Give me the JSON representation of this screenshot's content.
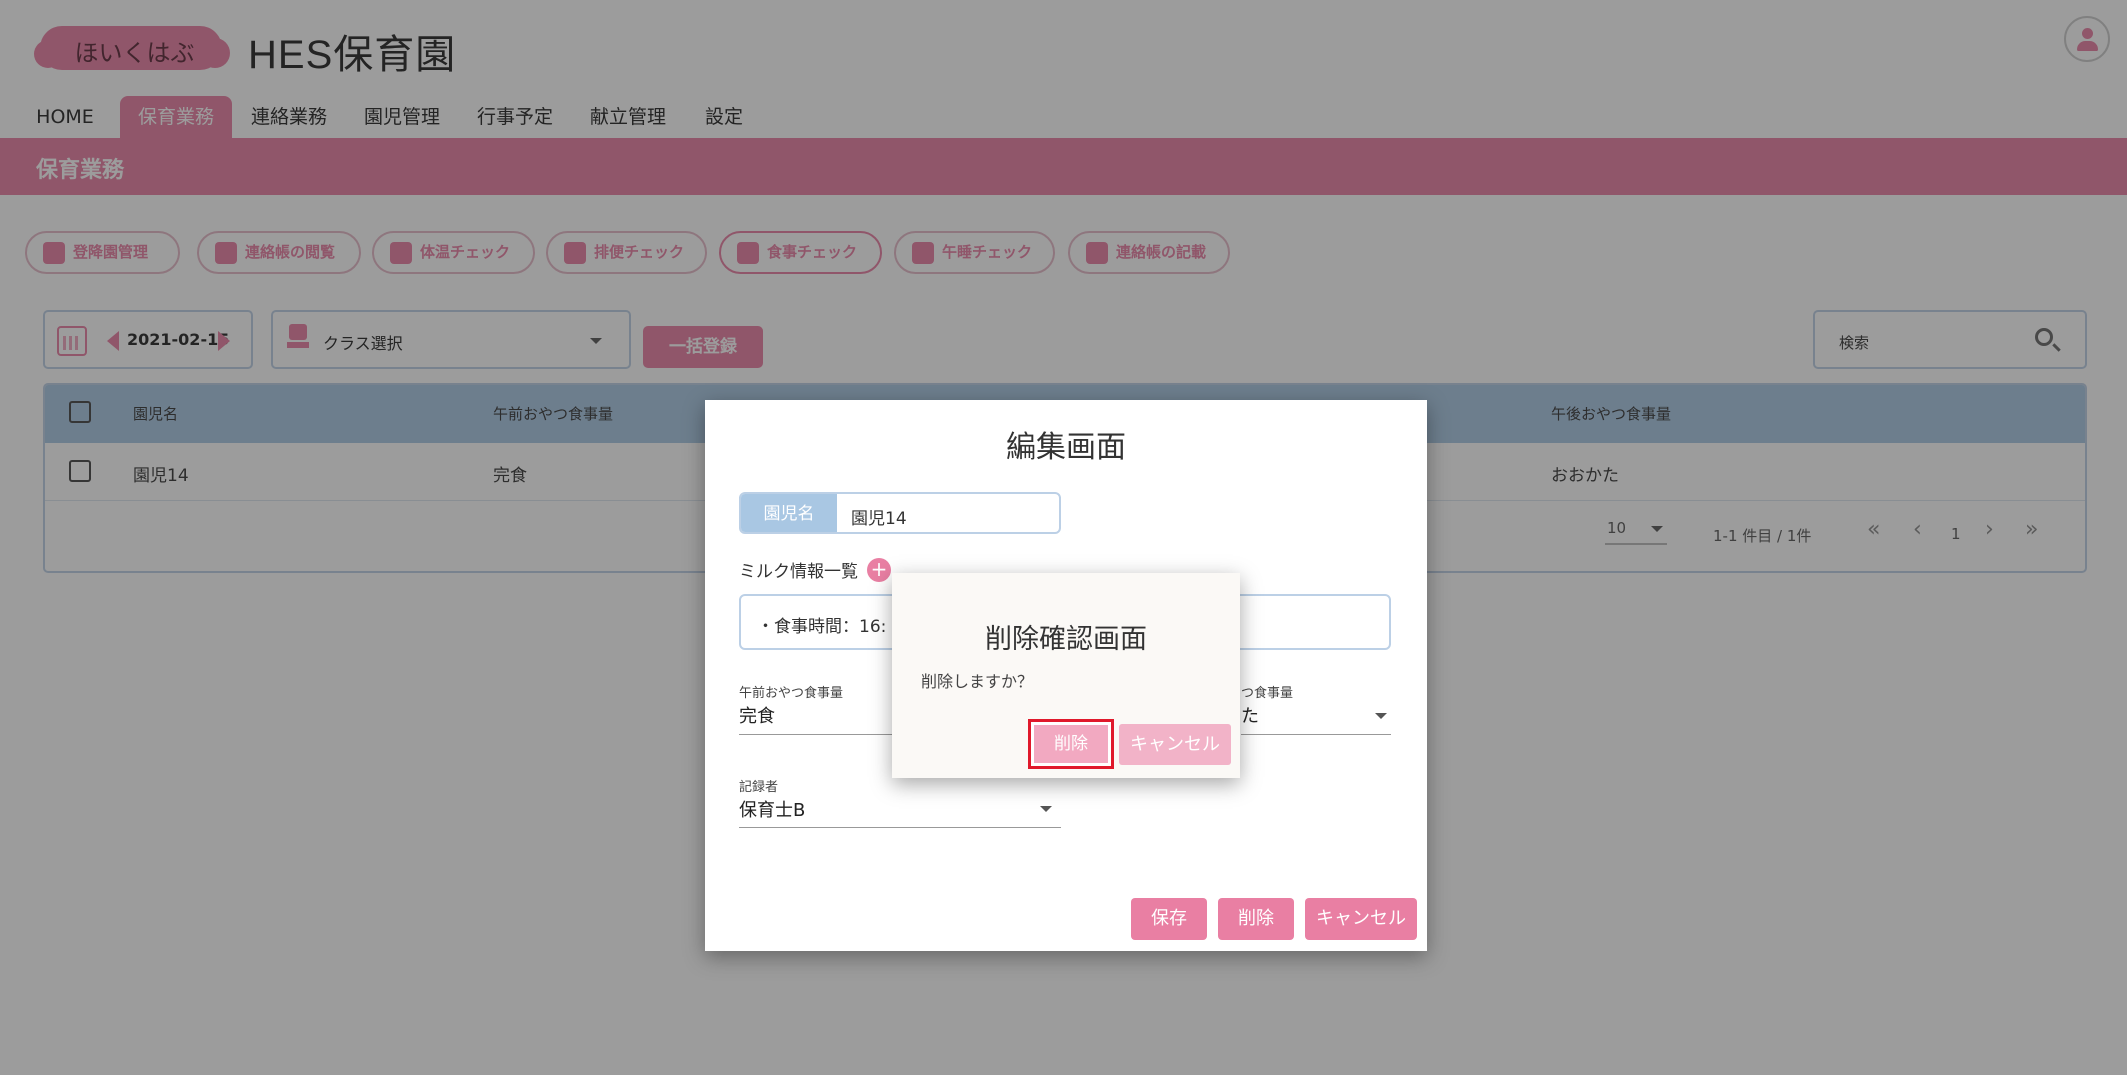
{
  "header": {
    "logo_text": "ほいくはぶ",
    "site_title": "HES保育園"
  },
  "nav": {
    "items": [
      "HOME",
      "保育業務",
      "連絡業務",
      "園児管理",
      "行事予定",
      "献立管理",
      "設定"
    ],
    "active_index": 1
  },
  "section": {
    "title": "保育業務"
  },
  "chips": [
    "登降園管理",
    "連絡帳の閲覧",
    "体温チェック",
    "排便チェック",
    "食事チェック",
    "午睡チェック",
    "連絡帳の記載"
  ],
  "toolbar": {
    "date": "2021-02-15",
    "class_select": "クラス選択",
    "bulk_button": "一括登録",
    "search_placeholder": "検索"
  },
  "table": {
    "headers": [
      "園児名",
      "午前おやつ食事量",
      "午後おやつ食事量"
    ],
    "rows": [
      {
        "name": "園児14",
        "am_snack": "完食",
        "pm_snack": "おおかた"
      }
    ],
    "rows_per_page": "10",
    "range_text": "1-1 件目 / 1件",
    "page": "1",
    "pager_first": "«",
    "pager_prev": "‹",
    "pager_next": "›",
    "pager_last": "»"
  },
  "edit_modal": {
    "title": "編集画面",
    "name_label": "園児名",
    "name_value": "園児14",
    "milk_label": "ミルク情報一覧",
    "milk_item": "・食事時間：16:",
    "am_snack_label": "午前おやつ食事量",
    "am_snack_value": "完食",
    "pm_snack_label": "つ食事量",
    "pm_snack_value": "た",
    "recorder_label": "記録者",
    "recorder_value": "保育士B",
    "save_button": "保存",
    "delete_button": "削除",
    "cancel_button": "キャンセル"
  },
  "confirm_dialog": {
    "title": "削除確認画面",
    "message": "削除しますか？",
    "delete_button": "削除",
    "cancel_button": "キャンセル"
  }
}
